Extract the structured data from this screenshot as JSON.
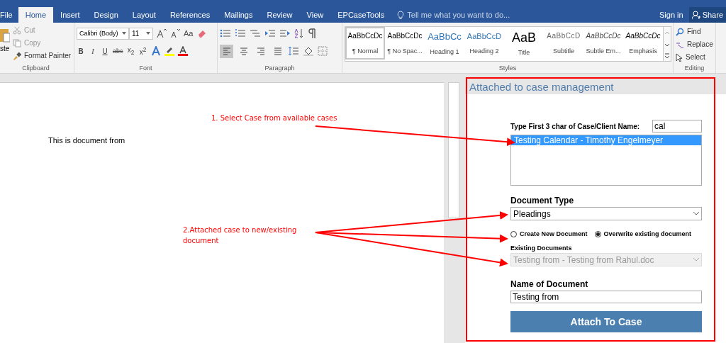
{
  "tabs": [
    {
      "label": "File",
      "selected": false
    },
    {
      "label": "Home",
      "selected": true
    },
    {
      "label": "Insert",
      "selected": false
    },
    {
      "label": "Design",
      "selected": false
    },
    {
      "label": "Layout",
      "selected": false
    },
    {
      "label": "References",
      "selected": false
    },
    {
      "label": "Mailings",
      "selected": false
    },
    {
      "label": "Review",
      "selected": false
    },
    {
      "label": "View",
      "selected": false
    },
    {
      "label": "EPCaseTools",
      "selected": false
    }
  ],
  "tell_me": {
    "placeholder": "Tell me what you want to do..."
  },
  "sign_in": "Sign in",
  "share": "Share",
  "clipboard": {
    "paste": "ste",
    "cut": "Cut",
    "copy": "Copy",
    "format_painter": "Format Painter",
    "label": "Clipboard"
  },
  "font": {
    "name": "Calibri (Body)",
    "size": "11",
    "change_case": "Aa",
    "format_buttons": [
      "B",
      "I",
      "U",
      "abc",
      "x$_{2}$",
      "x$^{2}$"
    ],
    "label": "Font"
  },
  "paragraph": {
    "align_buttons": [
      {
        "kind": "left",
        "selected": true
      },
      {
        "kind": "center",
        "selected": false
      },
      {
        "kind": "right",
        "selected": false
      },
      {
        "kind": "justify",
        "selected": false
      }
    ],
    "label": "Paragraph"
  },
  "styles": {
    "items": [
      {
        "preview": "AaBbCcDc",
        "name": "¶ Normal",
        "kind": "normal",
        "selected": true
      },
      {
        "preview": "AaBbCcDc",
        "name": "¶ No Spac...",
        "kind": "normal",
        "selected": false
      },
      {
        "preview": "AaBbCc",
        "name": "Heading 1",
        "kind": "heading1",
        "selected": false
      },
      {
        "preview": "AaBbCcD",
        "name": "Heading 2",
        "kind": "heading2",
        "selected": false
      },
      {
        "preview": "AaB",
        "name": "Title",
        "kind": "title",
        "selected": false
      },
      {
        "preview": "AaBbCcD",
        "name": "Subtitle",
        "kind": "subtitle",
        "selected": false
      },
      {
        "preview": "AaBbCcDc",
        "name": "Subtle Em...",
        "kind": "subtle",
        "selected": false
      },
      {
        "preview": "AaBbCcDc",
        "name": "Emphasis",
        "kind": "emphasis",
        "selected": false
      }
    ],
    "label": "Styles"
  },
  "editing": {
    "find": "Find",
    "replace": "Replace",
    "select": "Select",
    "label": "Editing"
  },
  "document": {
    "text": "This is document from"
  },
  "annotations": [
    {
      "text": "1. Select Case from available cases"
    },
    {
      "text": "2.Attached case to new/existing document"
    }
  ],
  "pane": {
    "title": "Attached to case management",
    "search_label": "Type First 3 char of Case/Client Name:",
    "search_value": "cal",
    "cases": [
      {
        "label": "Testing Calendar - Timothy Engelmeyer",
        "selected": true
      }
    ],
    "document_type_label": "Document Type",
    "document_type": "Pleadings",
    "options": [
      {
        "label": "Create New Document",
        "selected": false
      },
      {
        "label": "Overwrite existing document",
        "selected": true
      }
    ],
    "existing_label": "Existing Documents",
    "existing_value": "Testing from - Testing from Rahul.doc",
    "existing_disabled": true,
    "name_label": "Name of Document",
    "name_value": "Testing from",
    "button": "Attach To Case"
  }
}
